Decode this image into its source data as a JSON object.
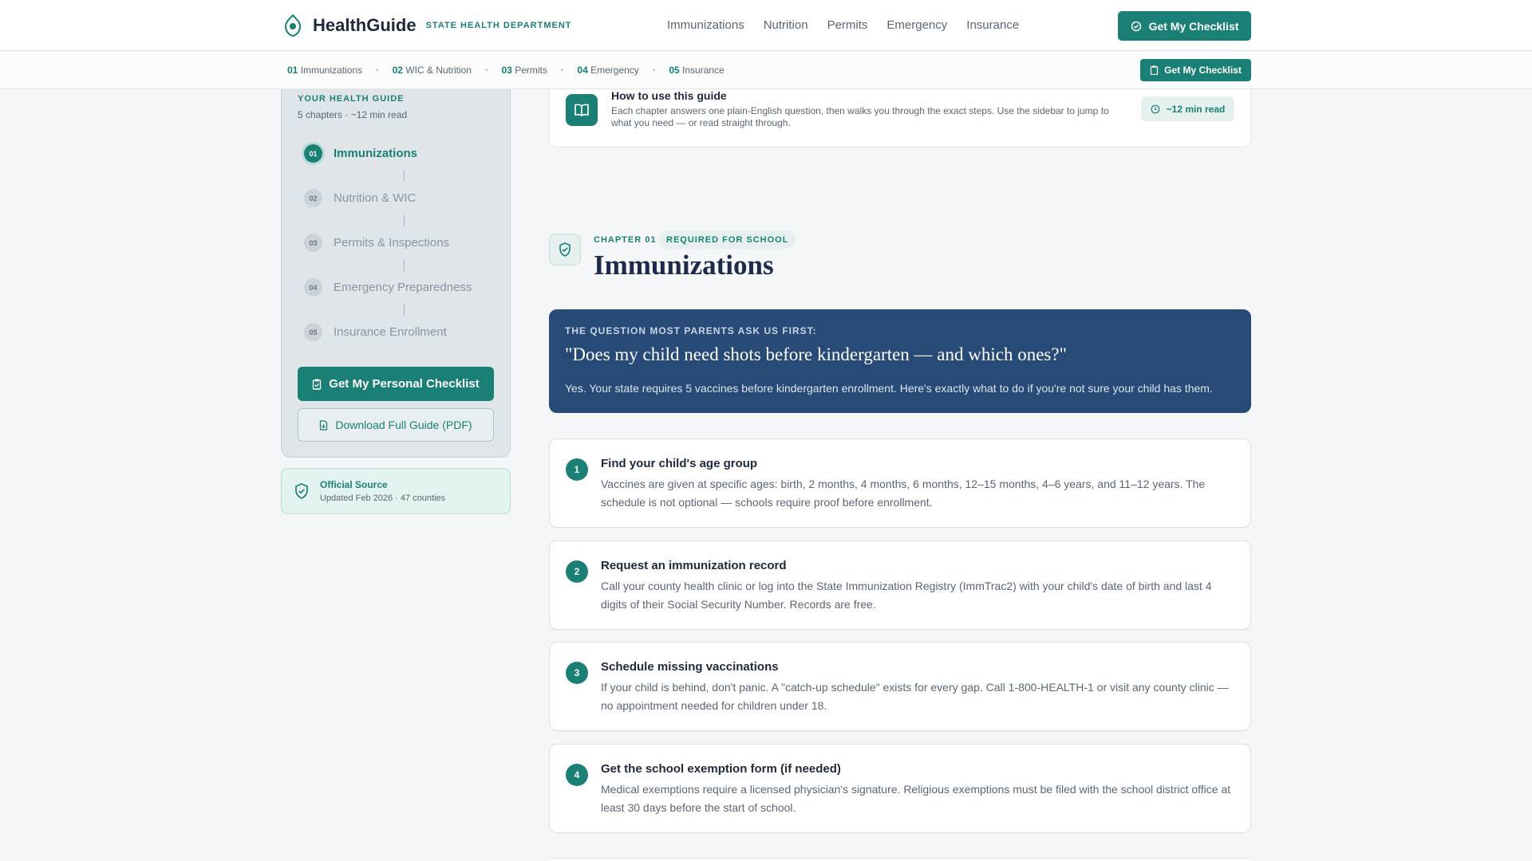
{
  "brand": {
    "name": "HealthGuide",
    "sub": "STATE HEALTH DEPARTMENT"
  },
  "nav": [
    "Immunizations",
    "Nutrition",
    "Permits",
    "Emergency",
    "Insurance"
  ],
  "header": {
    "cta": "Get My Checklist"
  },
  "strip": {
    "items": [
      {
        "num": "01",
        "label": "Immunizations"
      },
      {
        "num": "02",
        "label": "WIC & Nutrition"
      },
      {
        "num": "03",
        "label": "Permits"
      },
      {
        "num": "04",
        "label": "Emergency"
      },
      {
        "num": "05",
        "label": "Insurance"
      }
    ],
    "cta": "Get My Checklist"
  },
  "sidebar": {
    "label": "YOUR HEALTH GUIDE",
    "meta": "5 chapters · ~12 min read",
    "items": [
      {
        "num": "01",
        "label": "Immunizations",
        "active": true
      },
      {
        "num": "02",
        "label": "Nutrition & WIC",
        "active": false
      },
      {
        "num": "03",
        "label": "Permits & Inspections",
        "active": false
      },
      {
        "num": "04",
        "label": "Emergency Preparedness",
        "active": false
      },
      {
        "num": "05",
        "label": "Insurance Enrollment",
        "active": false
      }
    ],
    "primary_btn": "Get My Personal Checklist",
    "secondary_btn": "Download Full Guide (PDF)"
  },
  "source": {
    "title": "Official Source",
    "meta": "Updated Feb 2026 · 47 counties"
  },
  "howto": {
    "title": "How to use this guide",
    "text": "Each chapter answers one plain-English question, then walks you through the exact steps. Use the sidebar to jump to what you need — or read straight through.",
    "read_time": "~12 min read"
  },
  "chapter": {
    "kicker": "CHAPTER 01",
    "badge": "REQUIRED FOR SCHOOL",
    "title": "Immunizations"
  },
  "hero": {
    "kicker": "THE QUESTION MOST PARENTS ASK US FIRST:",
    "question": "\"Does my child need shots before kindergarten — and which ones?\"",
    "answer": "Yes. Your state requires 5 vaccines before kindergarten enrollment. Here's exactly what to do if you're not sure your child has them."
  },
  "steps": [
    {
      "num": "1",
      "title": "Find your child's age group",
      "text": "Vaccines are given at specific ages: birth, 2 months, 4 months, 6 months, 12–15 months, 4–6 years, and 11–12 years. The schedule is not optional — schools require proof before enrollment."
    },
    {
      "num": "2",
      "title": "Request an immunization record",
      "text": "Call your county health clinic or log into the State Immunization Registry (ImmTrac2) with your child's date of birth and last 4 digits of their Social Security Number. Records are free."
    },
    {
      "num": "3",
      "title": "Schedule missing vaccinations",
      "text": "If your child is behind, don't panic. A \"catch-up schedule\" exists for every gap. Call 1-800-HEALTH-1 or visit any county clinic — no appointment needed for children under 18."
    },
    {
      "num": "4",
      "title": "Get the school exemption form (if needed)",
      "text": "Medical exemptions require a licensed physician's signature. Religious exemptions must be filed with the school district office at least 30 days before the start of school."
    }
  ],
  "colors": {
    "accent": "#1a7f74",
    "hero": "#274b76",
    "text": "#1e2a3b"
  }
}
